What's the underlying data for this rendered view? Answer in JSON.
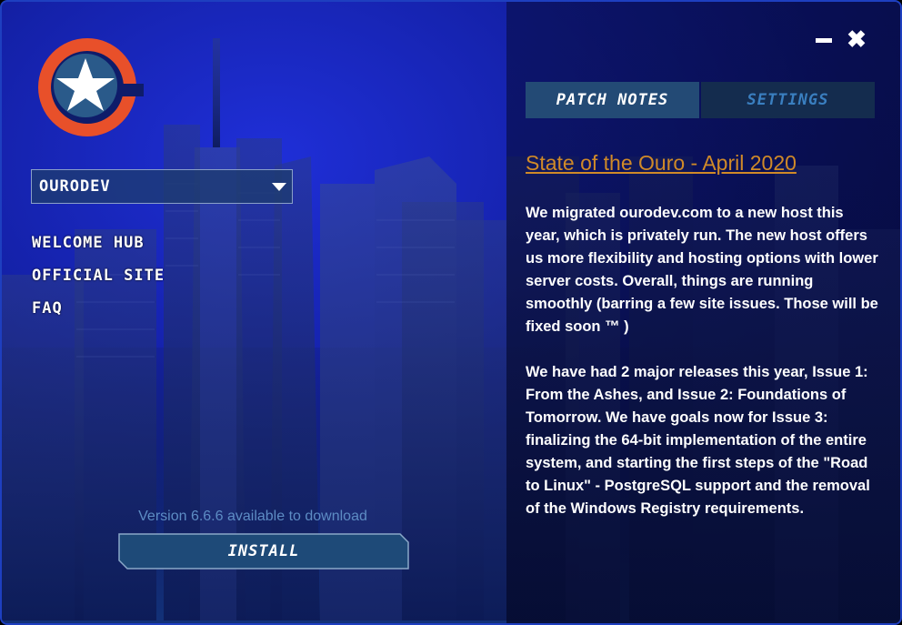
{
  "window": {
    "minimize_icon": "minimize-icon",
    "close_icon": "close-icon",
    "close_glyph": "✖"
  },
  "logo": {
    "icon": "star-logo-icon",
    "colors": {
      "ring": "#e8502a",
      "disc": "#2a5a8a",
      "star": "#ffffff"
    }
  },
  "server_select": {
    "value": "OURODEV",
    "icon": "chevron-down-icon"
  },
  "nav": [
    {
      "label": "WELCOME HUB"
    },
    {
      "label": "OFFICIAL SITE"
    },
    {
      "label": "FAQ"
    }
  ],
  "install": {
    "version_text": "Version 6.6.6 available to download",
    "button_label": "INSTALL"
  },
  "tabs": [
    {
      "label": "PATCH NOTES",
      "active": true
    },
    {
      "label": "SETTINGS",
      "active": false
    }
  ],
  "article": {
    "title": "State of the Ouro - April 2020",
    "paragraphs": [
      "We migrated ourodev.com to a new host this year, which is privately run.  The new host offers us more flexibility and hosting options with lower server costs.  Overall, things are running smoothly (barring a few site issues.  Those will be fixed soon ™ )",
      "We have had 2 major releases this year, Issue 1: From the Ashes, and Issue 2: Foundations of Tomorrow.  We have goals now for Issue 3: finalizing the 64-bit implementation of the entire system, and starting the first steps of the \"Road to Linux\" - PostgreSQL support and the removal of the Windows Registry requirements."
    ]
  },
  "colors": {
    "accent_orange": "#d08a28",
    "tab_active": "#234a75",
    "tab_inactive": "#142c4e",
    "version_text": "#5d8cc4"
  }
}
